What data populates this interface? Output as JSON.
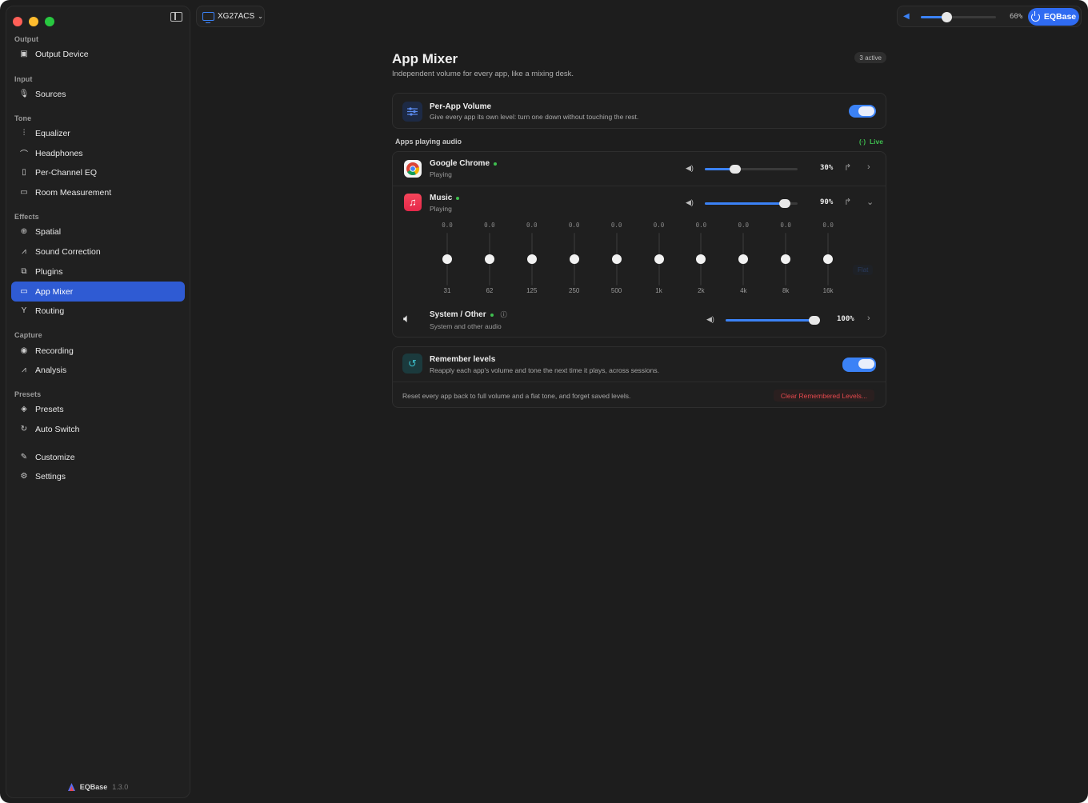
{
  "sidebar": {
    "sections": [
      {
        "label": "Output",
        "items": [
          {
            "label": "Output Device",
            "icon": "output-device-icon"
          }
        ]
      },
      {
        "label": "Input",
        "items": [
          {
            "label": "Sources",
            "icon": "mic-icon"
          }
        ]
      },
      {
        "label": "Tone",
        "items": [
          {
            "label": "Equalizer",
            "icon": "sliders-icon"
          },
          {
            "label": "Headphones",
            "icon": "headphones-icon"
          },
          {
            "label": "Per-Channel EQ",
            "icon": "speaker-icon"
          },
          {
            "label": "Room Measurement",
            "icon": "ruler-icon"
          }
        ]
      },
      {
        "label": "Effects",
        "items": [
          {
            "label": "Spatial",
            "icon": "globe-icon"
          },
          {
            "label": "Sound Correction",
            "icon": "waveform-icon"
          },
          {
            "label": "Plugins",
            "icon": "puzzle-icon"
          },
          {
            "label": "App Mixer",
            "icon": "laptop-icon"
          },
          {
            "label": "Routing",
            "icon": "split-icon"
          }
        ]
      },
      {
        "label": "Capture",
        "items": [
          {
            "label": "Recording",
            "icon": "record-icon"
          },
          {
            "label": "Analysis",
            "icon": "waveform-icon"
          }
        ]
      },
      {
        "label": "Presets",
        "items": [
          {
            "label": "Presets",
            "icon": "layers-icon"
          },
          {
            "label": "Auto Switch",
            "icon": "refresh-icon"
          }
        ]
      },
      {
        "label": "",
        "items": [
          {
            "label": "Customize",
            "icon": "brush-icon"
          },
          {
            "label": "Settings",
            "icon": "gear-icon"
          }
        ]
      }
    ],
    "footer": {
      "brand": "EQBase",
      "version": "1.3.0"
    }
  },
  "topbar": {
    "device": "XG27ACS",
    "volume_pct": "60%",
    "volume_level": 0.34,
    "power_label": "EQBase"
  },
  "main": {
    "title": "App Mixer",
    "subtitle": "Independent volume for every app, like a mixing desk.",
    "badge": "3 active",
    "per_app": {
      "title": "Per-App Volume",
      "subtitle": "Give every app its own level: turn one down without touching the rest.",
      "enabled": true
    },
    "apps_label": "Apps playing audio",
    "live_label": "Live",
    "apps": [
      {
        "name": "Google Chrome",
        "status": "Playing",
        "volume": "30%",
        "level": 0.33
      },
      {
        "name": "Music",
        "status": "Playing",
        "volume": "90%",
        "level": 0.86
      },
      {
        "name": "System / Other",
        "status": "System and other audio",
        "volume": "100%",
        "level": 0.96
      }
    ],
    "eq": {
      "bands": [
        "31",
        "62",
        "125",
        "250",
        "500",
        "1k",
        "2k",
        "4k",
        "8k",
        "16k"
      ],
      "values": [
        "0.0",
        "0.0",
        "0.0",
        "0.0",
        "0.0",
        "0.0",
        "0.0",
        "0.0",
        "0.0",
        "0.0"
      ],
      "flat_label": "Flat"
    },
    "remember": {
      "title": "Remember levels",
      "subtitle": "Reapply each app's volume and tone the next time it plays, across sessions.",
      "enabled": true,
      "reset_text": "Reset every app back to full volume and a flat tone, and forget saved levels.",
      "clear_label": "Clear Remembered Levels..."
    }
  },
  "colors": {
    "accent": "#3b82f6",
    "active_nav": "#2f5bd3",
    "live": "#3fbf4f",
    "danger": "#e5484d"
  }
}
